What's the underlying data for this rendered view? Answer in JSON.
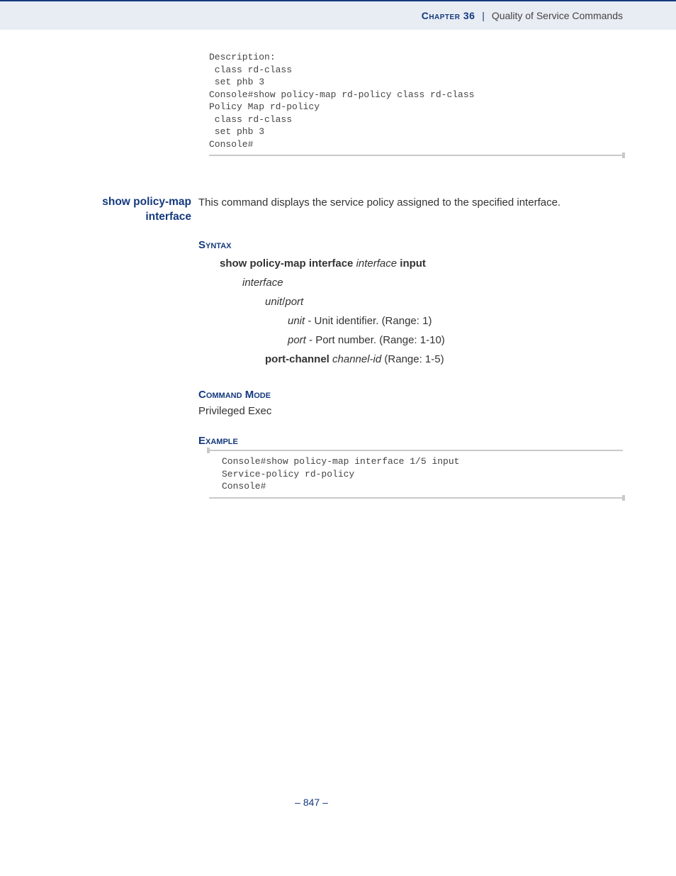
{
  "header": {
    "chapter_label": "Chapter 36",
    "separator": "|",
    "title": "Quality of Service Commands"
  },
  "code1": "Description:\n class rd-class\n set phb 3\nConsole#show policy-map rd-policy class rd-class\nPolicy Map rd-policy\n class rd-class\n set phb 3\nConsole#",
  "command": {
    "name_line1": "show policy-map",
    "name_line2": "interface",
    "description": "This command displays the service policy assigned to the specified interface."
  },
  "sections": {
    "syntax_label": "Syntax",
    "syntax_cmd_b1": "show policy-map interface",
    "syntax_cmd_i1": "interface",
    "syntax_cmd_b2": "input",
    "interface_i": "interface",
    "unit_i": "unit",
    "slash": "/",
    "port_i": "port",
    "unit_desc_i": "unit",
    "unit_desc_t": " - Unit identifier. (Range: 1)",
    "port_desc_i": "port",
    "port_desc_t": " - Port number. (Range: 1-10)",
    "pc_b": "port-channel",
    "pc_i": "channel-id",
    "pc_t": " (Range: 1-5)",
    "mode_label": "Command Mode",
    "mode_text": "Privileged Exec",
    "example_label": "Example"
  },
  "code2": "Console#show policy-map interface 1/5 input\nService-policy rd-policy\nConsole#",
  "footer": "– 847 –"
}
